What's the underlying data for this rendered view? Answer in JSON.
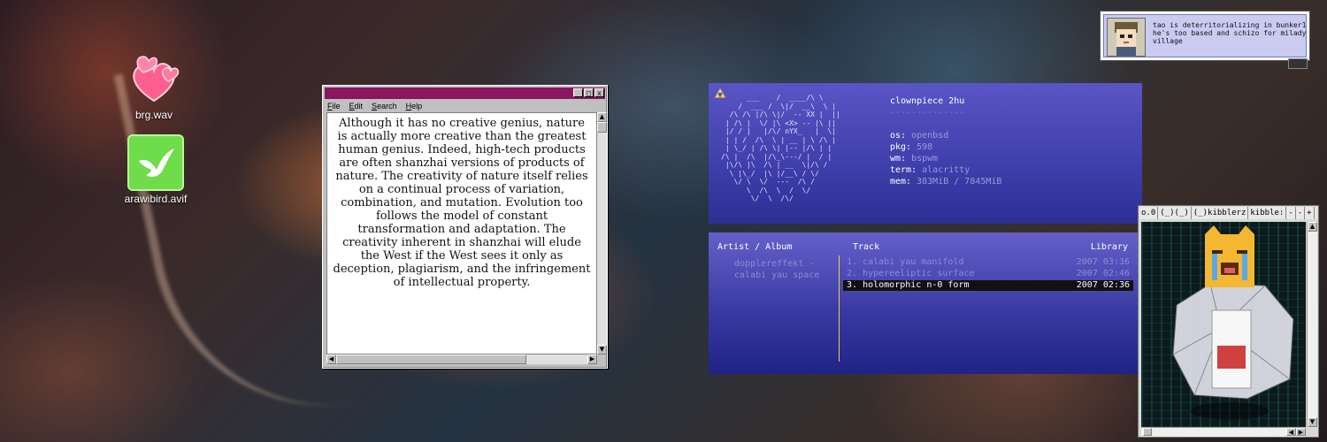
{
  "desktop": {
    "icons": [
      {
        "label": "brg.wav",
        "icon": "hearts-icon"
      },
      {
        "label": "arawibird.avif",
        "icon": "bird-icon"
      }
    ]
  },
  "notepad": {
    "menu": [
      "File",
      "Edit",
      "Search",
      "Help"
    ],
    "controls": {
      "minimize": "_",
      "maximize": "□",
      "close": "x"
    },
    "text": "Although it has no creative genius, nature is actually more creative than the greatest human genius. Indeed, high-tech products are often shanzhai versions of products of nature. The creativity of nature itself relies on a continual process of variation, combination, and mutation. Evolution too follows the model of constant transformation and adaptation. The creativity inherent in shanzhai will elude the West if the West sees it only as deception, plagiarism, and the infringement of intellectual property."
  },
  "fetch": {
    "host": "clownpiece 2hu",
    "separator": "--------------",
    "rows": [
      {
        "key": "os:",
        "value": "openbsd"
      },
      {
        "key": "pkg:",
        "value": "598"
      },
      {
        "key": "wm:",
        "value": "bspwm"
      },
      {
        "key": "term:",
        "value": "alacritty"
      },
      {
        "key": "mem:",
        "value": "383MiB / 7845MiB"
      }
    ],
    "ascii": "      ___    /  ____/\\ \\\n    /  ___ /  \\|/  __\\  \\ |\n  /\\ /\\ |/\\ \\|/  -- XX |  ||\n | /\\ |  \\/ |\\ <X> -- |\\ ||\n |/ / |   |/\\/ nYX_   |  \\|\n | | /  /\\  \\ | __ | \\ /\\ |\n | \\_/ | /\\ \\| |-- |/\\ | |\n/\\ |  /\\  |/\\_\\---/ |  / |\n |\\/\\ |\\  /\\ | __  \\|/\\ /\n  \\ |\\_/  |\\ |/__\\ / \\/\n   \\/ \\  \\/  ---  /\\ /\n      \\  /\\  \\  /  \\/\n       \\/  \\  /\\/"
  },
  "cmus": {
    "headers": {
      "artist": "Artist / Album",
      "track": "Track",
      "library": "Library"
    },
    "artist": "dopplereffekt -",
    "album": "calabi yau space",
    "tracks": [
      {
        "num": "1.",
        "title": "calabi yau manifold",
        "year": "2007",
        "duration": "03:36"
      },
      {
        "num": "2.",
        "title": "hypereeliptic surface",
        "year": "2007",
        "duration": "02:46"
      },
      {
        "num": "3.",
        "title": "holomorphic n-0 form",
        "year": "2007",
        "duration": "02:36"
      }
    ],
    "selected_index": 2
  },
  "tweet": {
    "text": "tao is deterritorializing in bunker1 he's too based and schizo for milady village"
  },
  "xwin": {
    "tabs": [
      "o.0",
      "(_)(_)",
      "(_)kibblerz",
      "kibble:",
      "-",
      "-",
      "+"
    ]
  },
  "colors": {
    "notepad_title": "#8a1660",
    "fetch_bg": "#4b49b8",
    "cmus_selected_bg": "#111111",
    "cmus_divider": "#e6d24a"
  }
}
